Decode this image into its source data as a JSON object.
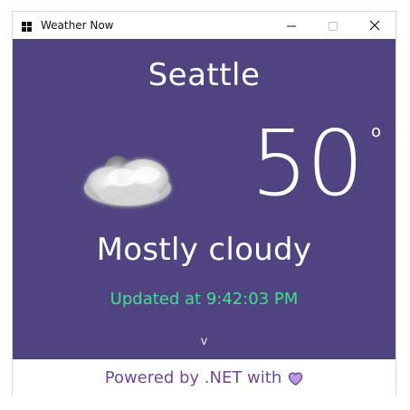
{
  "window": {
    "title": "Weather Now",
    "buttons": {
      "minimize": "—",
      "maximize": "☐",
      "close": "✕"
    }
  },
  "weather": {
    "city": "Seattle",
    "temperature": "50",
    "degree_symbol": "o",
    "condition": "Mostly cloudy",
    "updated_text": "Updated at 9:42:03 PM",
    "expand_label": "v",
    "icon": "mostly-cloudy-night-icon"
  },
  "footer": {
    "text": "Powered by .NET with",
    "icon": "heart-icon"
  },
  "colors": {
    "background": "#4f4480",
    "updated_text": "#3ee08f",
    "footer_text": "#6f4a9b"
  }
}
